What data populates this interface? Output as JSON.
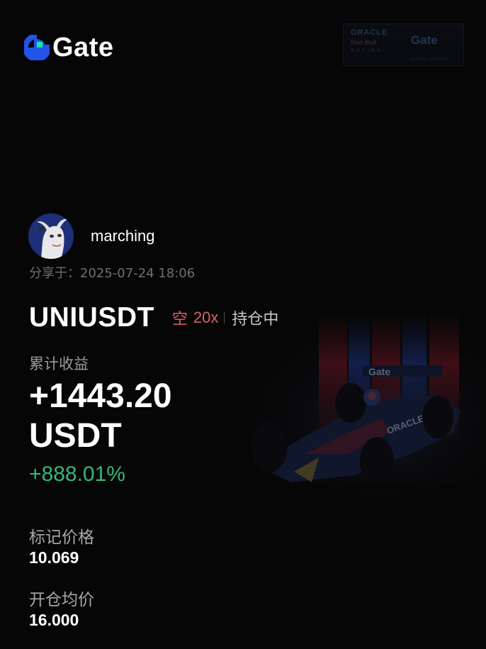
{
  "brand": {
    "name": "Gate",
    "accent_color": "#2354e6",
    "accent_green": "#17e6a1"
  },
  "sponsor": {
    "line1": "ORACLE",
    "line2": "Red Bull",
    "line3": "RACING",
    "partner": "Gate",
    "tagline": "OFFICIAL PARTNER"
  },
  "user": {
    "name": "marching",
    "share_label": "分享于：",
    "share_time": "2025-07-24 18:06"
  },
  "position": {
    "pair": "UNIUSDT",
    "side": "空",
    "leverage": "20x",
    "status": "持仓中",
    "side_color": "#e05d68"
  },
  "pnl": {
    "label": "累计收益",
    "value": "+1443.20",
    "unit": "USDT",
    "roi": "+888.01%",
    "roi_color": "#32b877"
  },
  "stats": {
    "mark_price_label": "标记价格",
    "mark_price": "10.069",
    "entry_price_label": "开仓均价",
    "entry_price": "16.000"
  }
}
